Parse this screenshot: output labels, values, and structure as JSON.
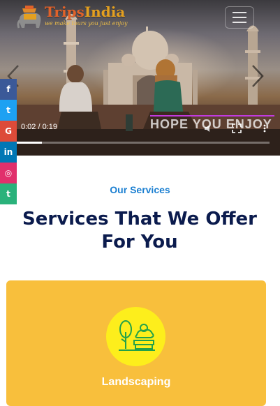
{
  "logo": {
    "name_part1": "Trips",
    "name_part2": "India",
    "tagline": "we make tours you just enjoy"
  },
  "header": {
    "menu_icon": "hamburger-icon"
  },
  "video": {
    "time": "0:02 / 0:19",
    "watermark": "HOPE YOU ENJOY",
    "progress": 0.105
  },
  "social": [
    {
      "name": "facebook",
      "glyph": "f",
      "color": "#3b5998"
    },
    {
      "name": "twitter",
      "glyph": "t",
      "color": "#1da1f2"
    },
    {
      "name": "google-plus",
      "glyph": "G",
      "color": "#dd4b39"
    },
    {
      "name": "linkedin",
      "glyph": "in",
      "color": "#0077b5"
    },
    {
      "name": "instagram",
      "glyph": "◎",
      "color": "#e1306c"
    },
    {
      "name": "tumblr",
      "glyph": "t",
      "color": "#2ab27b"
    }
  ],
  "services": {
    "eyebrow": "Our Services",
    "heading": "Services That We Offer For You",
    "cards": [
      {
        "title": "Landscaping",
        "icon": "landscaping-icon"
      }
    ]
  },
  "colors": {
    "accent": "#1b7fd1",
    "heading": "#0b1b4d",
    "card": "#f8bf3c",
    "icon_circle": "#fdee1c"
  }
}
